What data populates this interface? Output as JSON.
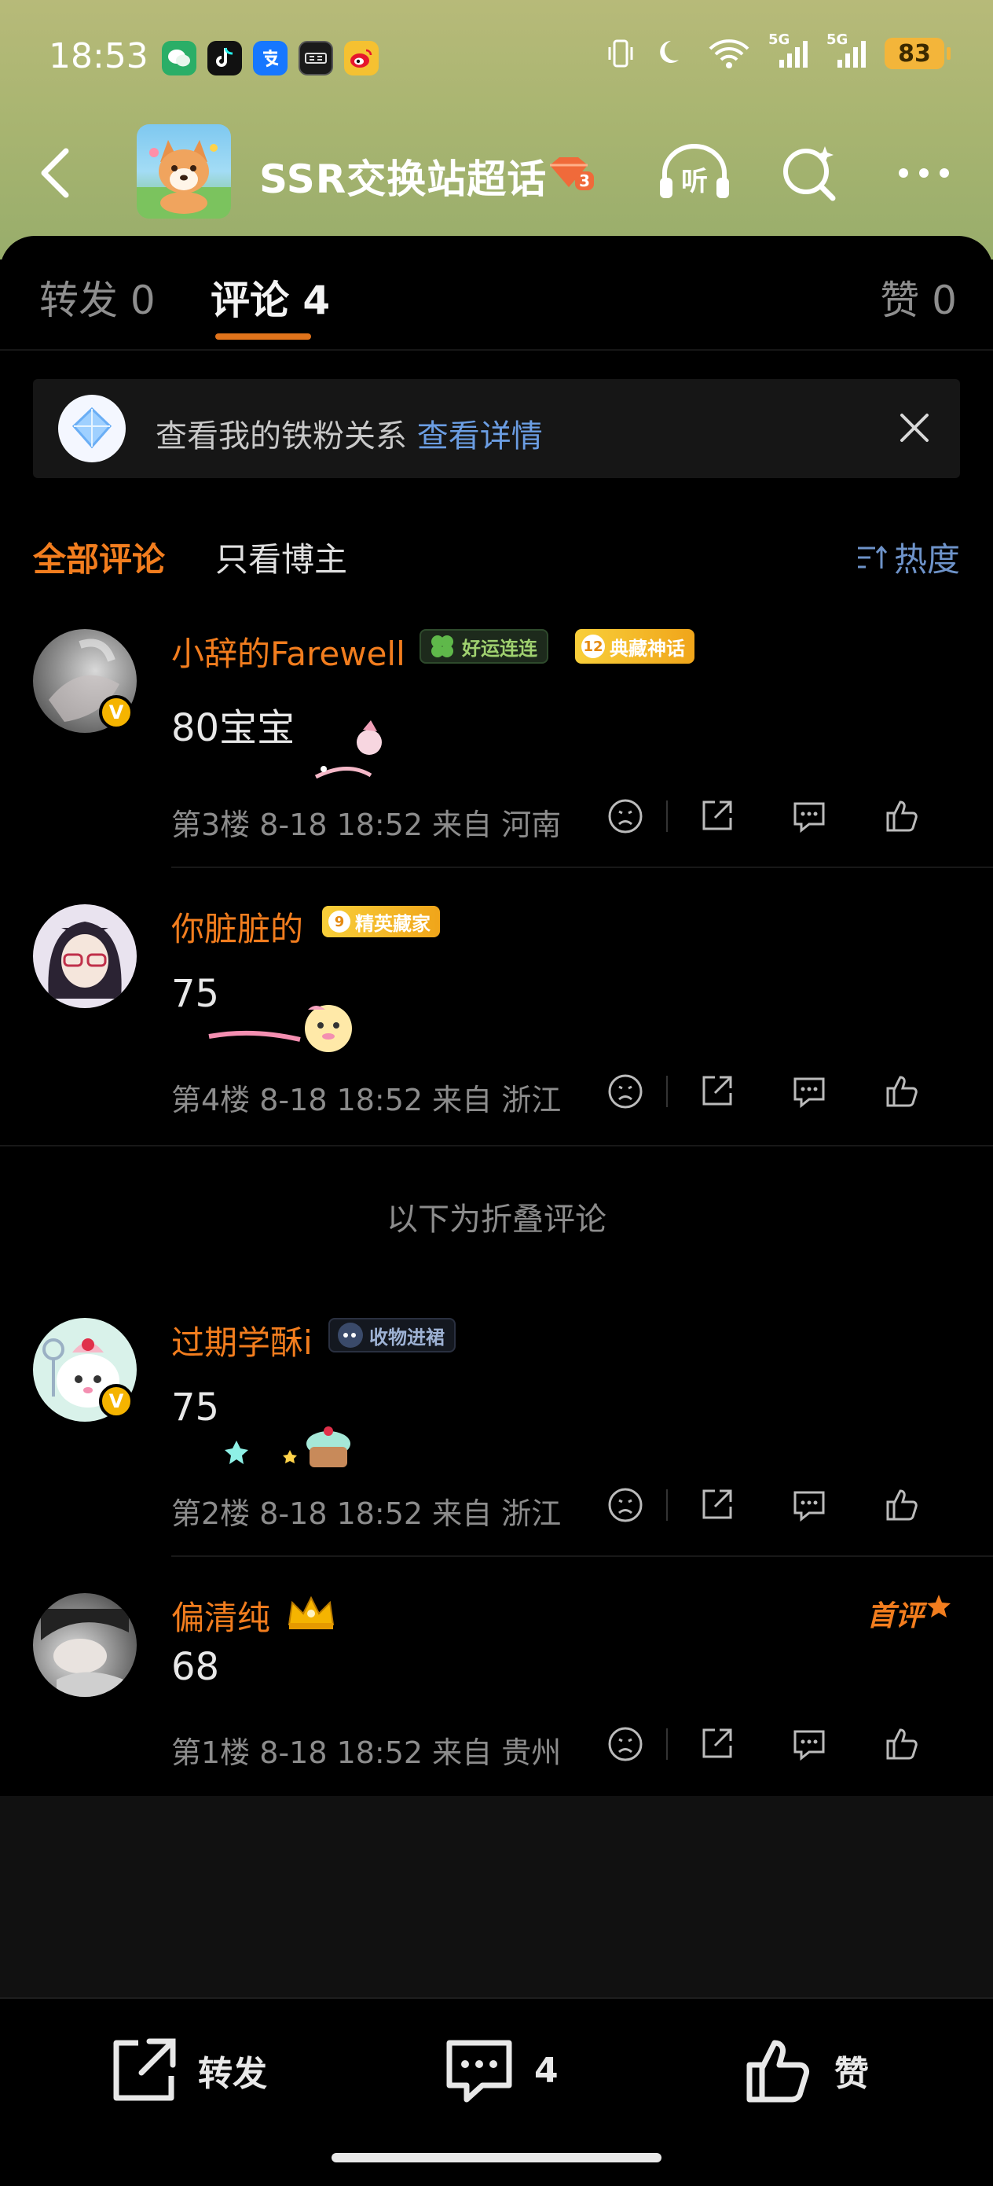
{
  "status_bar": {
    "time": "18:53",
    "battery": "83",
    "signal_1": "5G",
    "signal_2": "5G"
  },
  "nav": {
    "title": "SSR交换站超话",
    "level_badge": "3",
    "listen_label": "听"
  },
  "tabs": [
    {
      "label": "转发 0"
    },
    {
      "label": "评论 4"
    },
    {
      "label": "赞 0"
    }
  ],
  "iron_fan": {
    "text": "查看我的铁粉关系",
    "link": "查看详情"
  },
  "filters": {
    "all": "全部评论",
    "blogger_only": "只看博主",
    "sort": "热度"
  },
  "folded_label": "以下为折叠评论",
  "comments": [
    {
      "name": "小辞的Farewell",
      "tag1": "好运连连",
      "tag2_level": "12",
      "tag2": "典藏神话",
      "text": "80宝宝",
      "meta": "第3楼  8-18 18:52  来自 河南"
    },
    {
      "name": "你脏脏的",
      "tag1_level": "9",
      "tag1": "精英藏家",
      "text": "75",
      "meta": "第4楼  8-18 18:52  来自 浙江"
    },
    {
      "name": "过期学酥i",
      "tag1": "收物进裙",
      "text": "75",
      "meta": "第2楼  8-18 18:52  来自 浙江"
    },
    {
      "name": "偏清纯",
      "first_label": "首评",
      "text": "68",
      "meta": "第1楼  8-18 18:52  来自 贵州"
    }
  ],
  "bottom_bar": {
    "repost": "转发",
    "comments": "4",
    "like": "赞"
  },
  "colors": {
    "accent": "#f27d1e",
    "link": "#6b9de2",
    "header_green": "#a9b571"
  }
}
